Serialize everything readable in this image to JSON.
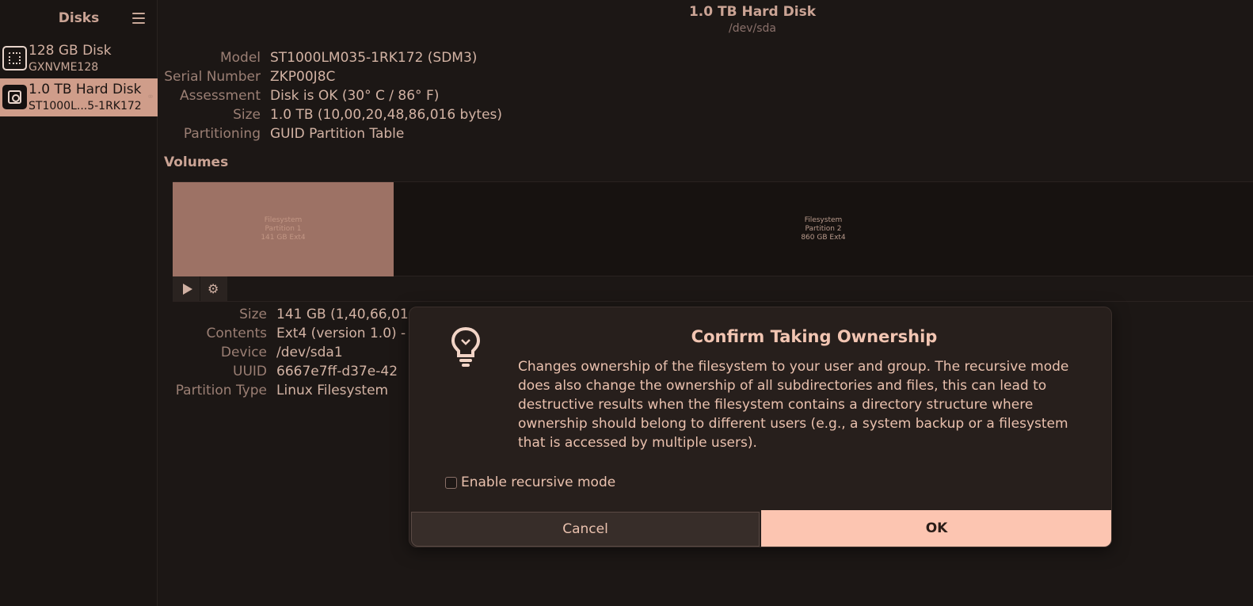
{
  "sidebar": {
    "title": "Disks",
    "disks": [
      {
        "name": "128 GB Disk",
        "subtitle": "GXNVME128",
        "icon": "ssd-icon"
      },
      {
        "name": "1.0 TB Hard Disk",
        "subtitle": "ST1000L...5-1RK172",
        "icon": "hdd-icon"
      }
    ]
  },
  "header": {
    "title": "1.0 TB Hard Disk",
    "subtitle": "/dev/sda"
  },
  "disk_info": [
    {
      "label": "Model",
      "value": "ST1000LM035-1RK172 (SDM3)"
    },
    {
      "label": "Serial Number",
      "value": "ZKP00J8C"
    },
    {
      "label": "Assessment",
      "value": "Disk is OK (30° C / 86° F)"
    },
    {
      "label": "Size",
      "value": "1.0 TB (10,00,20,48,86,016 bytes)"
    },
    {
      "label": "Partitioning",
      "value": "GUID Partition Table"
    }
  ],
  "volumes": {
    "title": "Volumes",
    "partitions": [
      {
        "line1": "Filesystem",
        "line2": "Partition 1",
        "line3": "141 GB Ext4"
      },
      {
        "line1": "Filesystem",
        "line2": "Partition 2",
        "line3": "860 GB Ext4"
      }
    ]
  },
  "partition_info": [
    {
      "label": "Size",
      "value": "141 GB (1,40,66,01,"
    },
    {
      "label": "Contents",
      "value": "Ext4 (version 1.0) -"
    },
    {
      "label": "Device",
      "value": "/dev/sda1"
    },
    {
      "label": "UUID",
      "value": "6667e7ff-d37e-42"
    },
    {
      "label": "Partition Type",
      "value": "Linux Filesystem"
    }
  ],
  "dialog": {
    "title": "Confirm Taking Ownership",
    "body": "Changes ownership of the filesystem to your user and group. The recursive mode does also change the ownership of all subdirectories and files, this can lead to destructive results when the filesystem contains a directory structure where ownership should belong to different users (e.g., a system backup or a filesystem that is accessed by multiple users).",
    "checkbox_label": "Enable recursive mode",
    "checkbox_checked": false,
    "cancel_label": "Cancel",
    "ok_label": "OK",
    "icon": "lightbulb-icon"
  },
  "colors": {
    "accent": "#fcc5b1",
    "selected": "#cf9d8a",
    "background": "#1c1715"
  }
}
